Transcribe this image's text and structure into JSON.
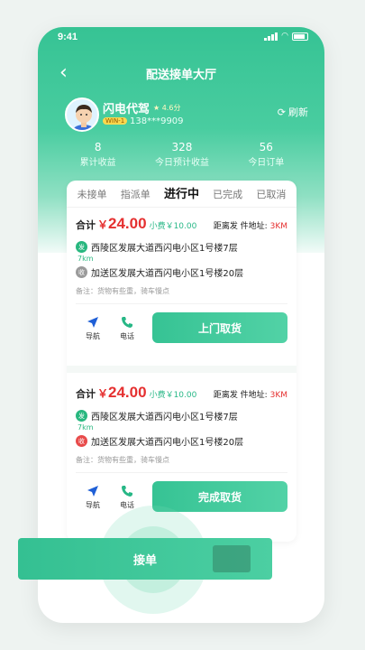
{
  "status_bar": {
    "time": "9:41"
  },
  "header": {
    "title": "配送接单大厅"
  },
  "profile": {
    "name": "闪电代驾",
    "rating": "★ 4.6分",
    "vip": "WIN-1",
    "phone": "138***9909",
    "refresh_label": "刷新"
  },
  "stats": [
    {
      "value": "8",
      "label": "累计收益"
    },
    {
      "value": "328",
      "label": "今日预计收益"
    },
    {
      "value": "56",
      "label": "今日订单"
    }
  ],
  "tabs": [
    {
      "label": "未接单"
    },
    {
      "label": "指派单"
    },
    {
      "label": "进行中"
    },
    {
      "label": "已完成"
    },
    {
      "label": "已取消"
    }
  ],
  "orders": [
    {
      "total_label": "合计",
      "currency": "￥",
      "amount": "24.00",
      "tip": "小费￥10.00",
      "distance_label": "距离发 件地址:",
      "distance_km": "3KM",
      "pickup_tag": "发",
      "pickup": "西陵区发展大道西闪电小区1号楼7层",
      "km": "7km",
      "dropoff_tag": "收",
      "dropoff": "加送区发展大道西闪电小区1号楼20层",
      "note": "备注：货物有些重，骑车慢点",
      "nav_label": "导航",
      "call_label": "电话",
      "button": "上门取货"
    },
    {
      "total_label": "合计",
      "currency": "￥",
      "amount": "24.00",
      "tip": "小费￥10.00",
      "distance_label": "距离发 件地址:",
      "distance_km": "3KM",
      "pickup_tag": "发",
      "pickup": "西陵区发展大道西闪电小区1号楼7层",
      "km": "7km",
      "dropoff_tag": "收",
      "dropoff": "加送区发展大道西闪电小区1号楼20层",
      "note": "备注：货物有些重，骑车慢点",
      "nav_label": "导航",
      "call_label": "电话",
      "button": "完成取货"
    }
  ],
  "bottom_button": "接单",
  "colors": {
    "accent": "#36c394",
    "price": "#e53030"
  }
}
